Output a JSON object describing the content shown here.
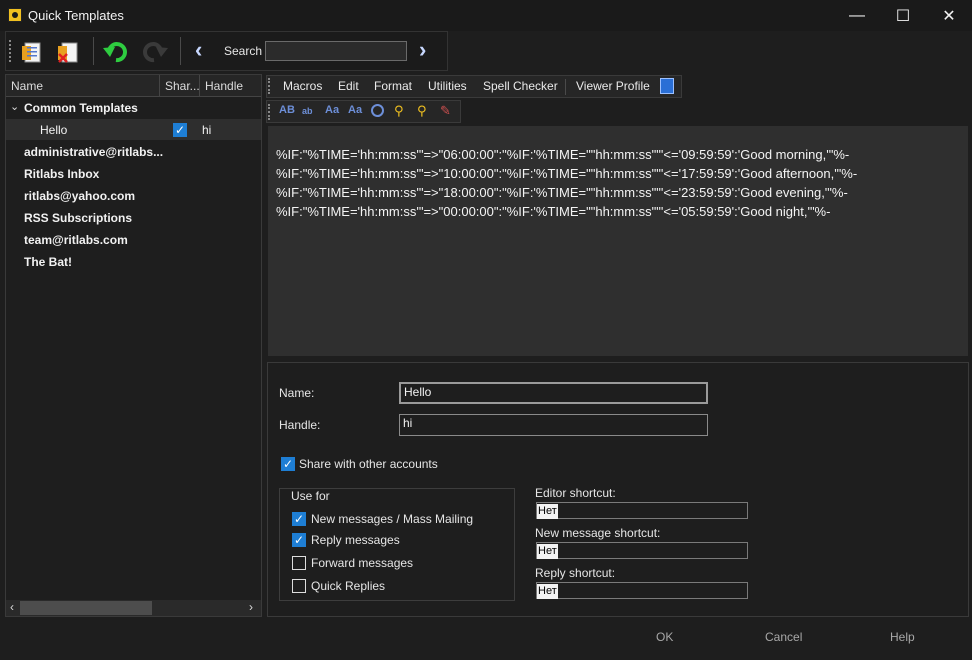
{
  "window": {
    "title": "Quick Templates",
    "minimize": "—",
    "maximize": "☐",
    "close": "✕"
  },
  "toolbar": {
    "search_label": "Search",
    "search_value": ""
  },
  "left": {
    "columns": [
      "Name",
      "Shar...",
      "Handle"
    ],
    "group": "Common Templates",
    "items": [
      {
        "name": "Hello",
        "shared": true,
        "handle": "hi"
      }
    ],
    "accounts": [
      "administrative@ritlabs...",
      "Ritlabs Inbox",
      "ritlabs@yahoo.com",
      "RSS Subscriptions",
      "team@ritlabs.com",
      "The Bat!"
    ]
  },
  "menus": [
    "Macros",
    "Edit",
    "Format",
    "Utilities",
    "Spell Checker",
    "Viewer Profile"
  ],
  "format_icons": [
    "AB",
    "ab",
    "Aa",
    "Aa"
  ],
  "editor": {
    "lines": [
      "%IF:\"%TIME='hh:mm:ss'\"=>\"06:00:00\":\"%IF:'%TIME=\"\"hh:mm:ss\"\"'<='09:59:59':'Good morning,'\"%-",
      "%IF:\"%TIME='hh:mm:ss'\"=>\"10:00:00\":\"%IF:'%TIME=\"\"hh:mm:ss\"\"'<='17:59:59':'Good afternoon,'\"%-",
      "%IF:\"%TIME='hh:mm:ss'\"=>\"18:00:00\":\"%IF:'%TIME=\"\"hh:mm:ss\"\"'<='23:59:59':'Good evening,'\"%-",
      "%IF:\"%TIME='hh:mm:ss'\"=>\"00:00:00\":\"%IF:'%TIME=\"\"hh:mm:ss\"\"'<='05:59:59':'Good night,'\"%-"
    ]
  },
  "form": {
    "name_label": "Name:",
    "name_value": "Hello",
    "handle_label": "Handle:",
    "handle_value": "hi",
    "share_label": "Share with other accounts",
    "share_checked": true,
    "usefor_title": "Use for",
    "usefor": [
      {
        "label": "New messages / Mass Mailing",
        "checked": true
      },
      {
        "label": "Reply messages",
        "checked": true
      },
      {
        "label": "Forward messages",
        "checked": false
      },
      {
        "label": "Quick Replies",
        "checked": false
      }
    ],
    "editor_shortcut_label": "Editor shortcut:",
    "editor_shortcut_value": "Нет",
    "newmsg_shortcut_label": "New message shortcut:",
    "newmsg_shortcut_value": "Нет",
    "reply_shortcut_label": "Reply shortcut:",
    "reply_shortcut_value": "Нет"
  },
  "buttons": {
    "ok": "OK",
    "cancel": "Cancel",
    "help": "Help"
  }
}
